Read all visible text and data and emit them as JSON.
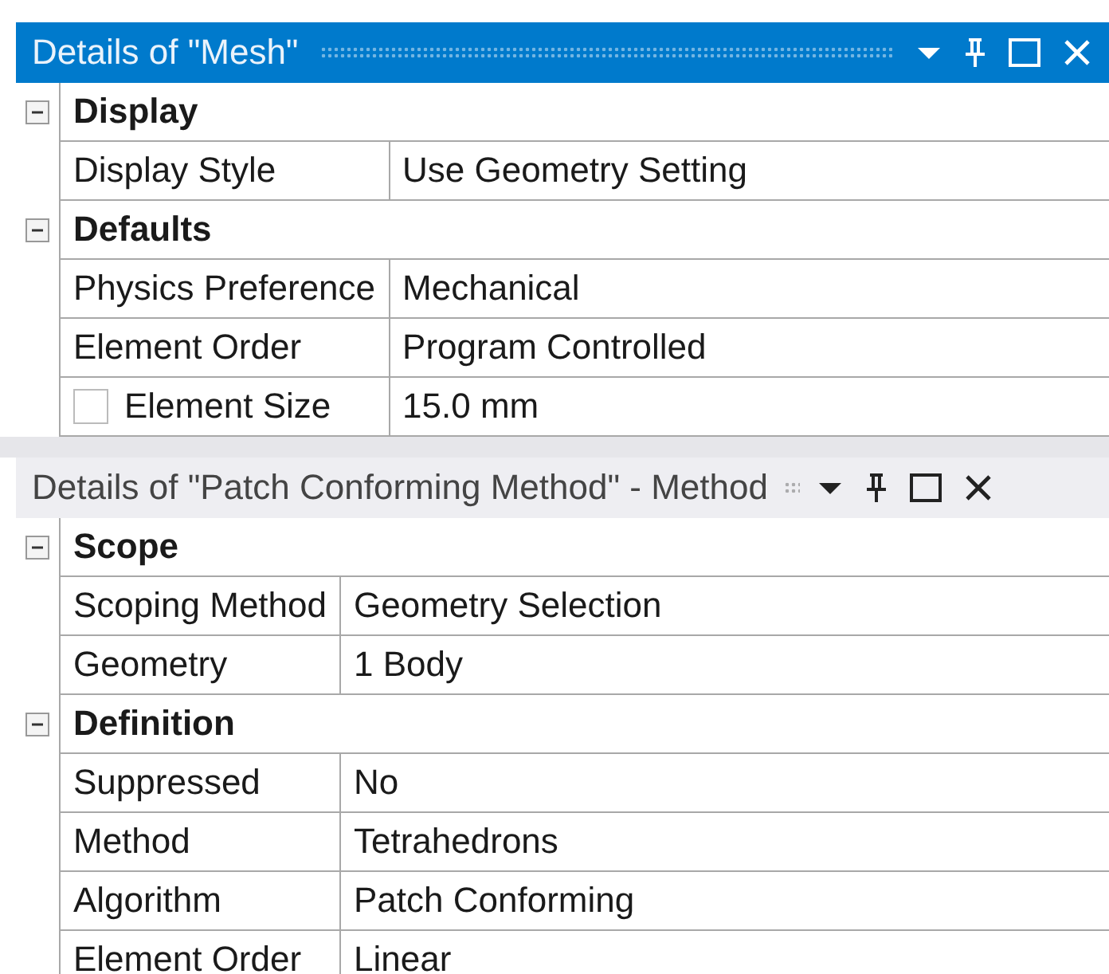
{
  "panels": [
    {
      "title": "Details of \"Mesh\"",
      "active": true,
      "groups": [
        {
          "name": "Display",
          "expanded": true,
          "rows": [
            {
              "label": "Display Style",
              "value": "Use Geometry Setting"
            }
          ]
        },
        {
          "name": "Defaults",
          "expanded": true,
          "rows": [
            {
              "label": "Physics Preference",
              "value": "Mechanical"
            },
            {
              "label": "Element Order",
              "value": "Program Controlled"
            },
            {
              "label": "Element Size",
              "value": "15.0 mm",
              "checked": false
            }
          ]
        }
      ]
    },
    {
      "title": "Details of \"Patch Conforming Method\" - Method",
      "active": false,
      "groups": [
        {
          "name": "Scope",
          "expanded": true,
          "rows": [
            {
              "label": "Scoping Method",
              "value": "Geometry Selection"
            },
            {
              "label": "Geometry",
              "value": "1 Body"
            }
          ]
        },
        {
          "name": "Definition",
          "expanded": true,
          "rows": [
            {
              "label": "Suppressed",
              "value": "No"
            },
            {
              "label": "Method",
              "value": "Tetrahedrons"
            },
            {
              "label": "Algorithm",
              "value": "Patch Conforming"
            },
            {
              "label": "Element Order",
              "value": "Linear"
            }
          ]
        }
      ]
    }
  ]
}
